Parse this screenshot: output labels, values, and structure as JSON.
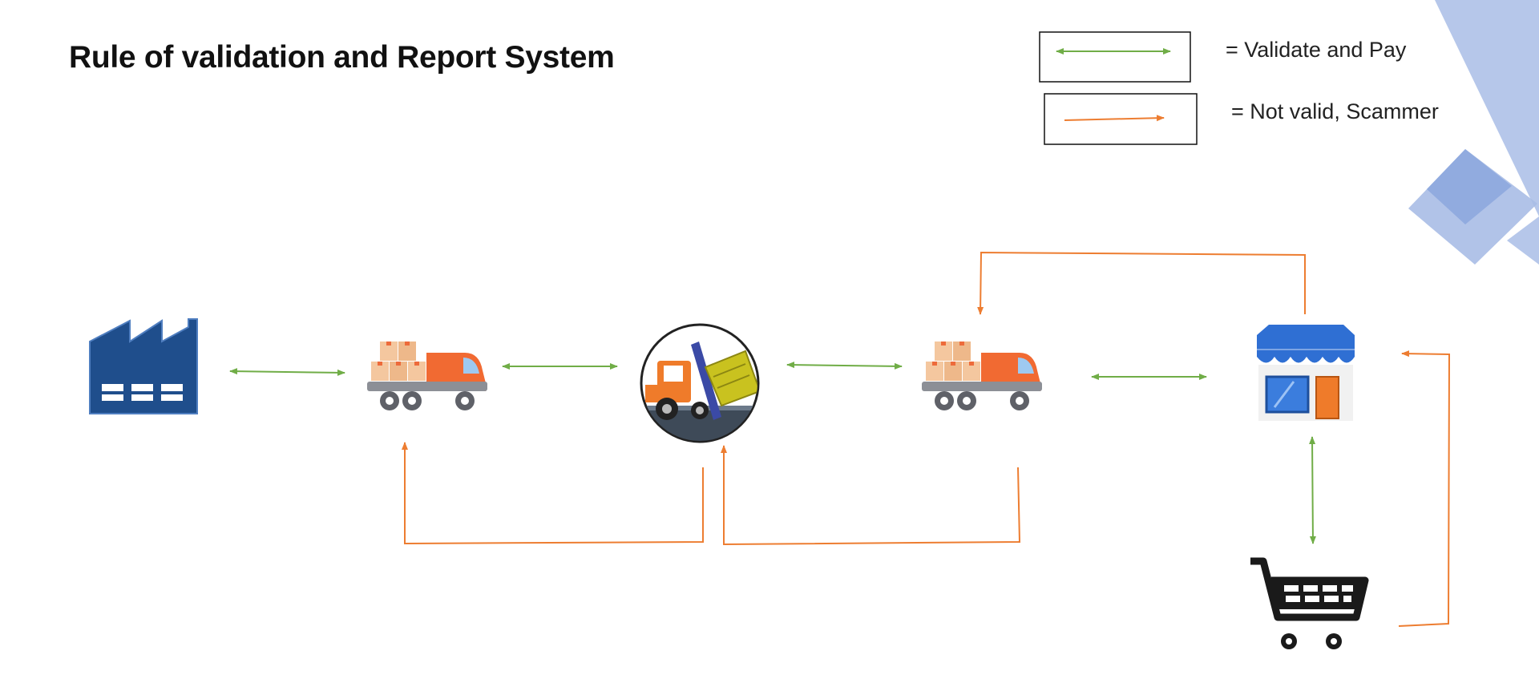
{
  "title": "Rule of validation and Report System",
  "legend": {
    "green_label": "= Validate and Pay",
    "orange_label": "= Not valid, Scammer"
  },
  "colors": {
    "valid": "#70ad47",
    "invalid": "#ed7d31",
    "decor": "#a9bde6",
    "decor_dark": "#8ea8de",
    "factory": "#1f4e8c"
  },
  "nodes": [
    {
      "id": "factory",
      "icon": "factory-icon"
    },
    {
      "id": "truck-1",
      "icon": "delivery-truck-icon"
    },
    {
      "id": "warehouse",
      "icon": "forklift-icon"
    },
    {
      "id": "truck-2",
      "icon": "delivery-truck-icon"
    },
    {
      "id": "store",
      "icon": "storefront-icon"
    },
    {
      "id": "customer",
      "icon": "shopping-cart-icon"
    }
  ],
  "edges": [
    {
      "from": "factory",
      "to": "truck-1",
      "type": "valid"
    },
    {
      "from": "truck-1",
      "to": "warehouse",
      "type": "valid"
    },
    {
      "from": "warehouse",
      "to": "truck-2",
      "type": "valid"
    },
    {
      "from": "truck-2",
      "to": "store",
      "type": "valid"
    },
    {
      "from": "store",
      "to": "customer",
      "type": "valid"
    },
    {
      "from": "warehouse",
      "to": "truck-1",
      "type": "invalid"
    },
    {
      "from": "truck-2",
      "to": "warehouse",
      "type": "invalid"
    },
    {
      "from": "store",
      "to": "truck-2",
      "type": "invalid"
    },
    {
      "from": "customer",
      "to": "store",
      "type": "invalid"
    }
  ]
}
